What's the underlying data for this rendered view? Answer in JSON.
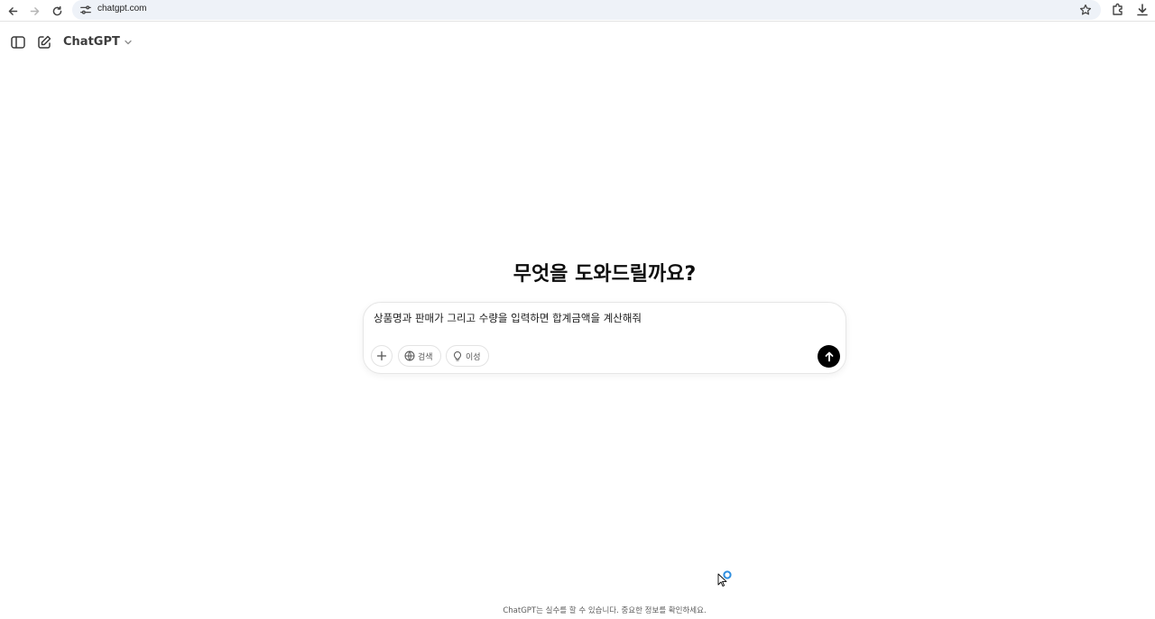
{
  "browser": {
    "url": "chatgpt.com",
    "icons": {
      "back": "arrow-left-icon",
      "forward": "arrow-right-icon",
      "reload": "reload-icon",
      "site_info": "tune-icon",
      "bookmark": "star-icon",
      "extensions": "puzzle-icon",
      "downloads": "download-icon"
    }
  },
  "header": {
    "model_name": "ChatGPT",
    "icons": {
      "sidebar_toggle": "sidebar-icon",
      "new_chat": "edit-icon",
      "model_chevron": "chevron-down-icon"
    }
  },
  "main": {
    "headline": "무엇을 도와드릴까요?"
  },
  "composer": {
    "input_value": "상품명과 판매가 그리고 수량을 입력하면 합계금액을 계산해줘",
    "search_label": "검색",
    "reason_label": "이성",
    "icons": {
      "attach": "plus-icon",
      "search": "globe-icon",
      "reason": "lightbulb-icon",
      "send": "arrow-up-icon"
    }
  },
  "footer": {
    "disclaimer": "ChatGPT는 실수를 할 수 있습니다. 중요한 정보를 확인하세요."
  },
  "colors": {
    "background": "#ffffff",
    "send_button": "#000000",
    "omnibox": "#eef2f8",
    "cursor_ring": "#2f8fe0"
  }
}
